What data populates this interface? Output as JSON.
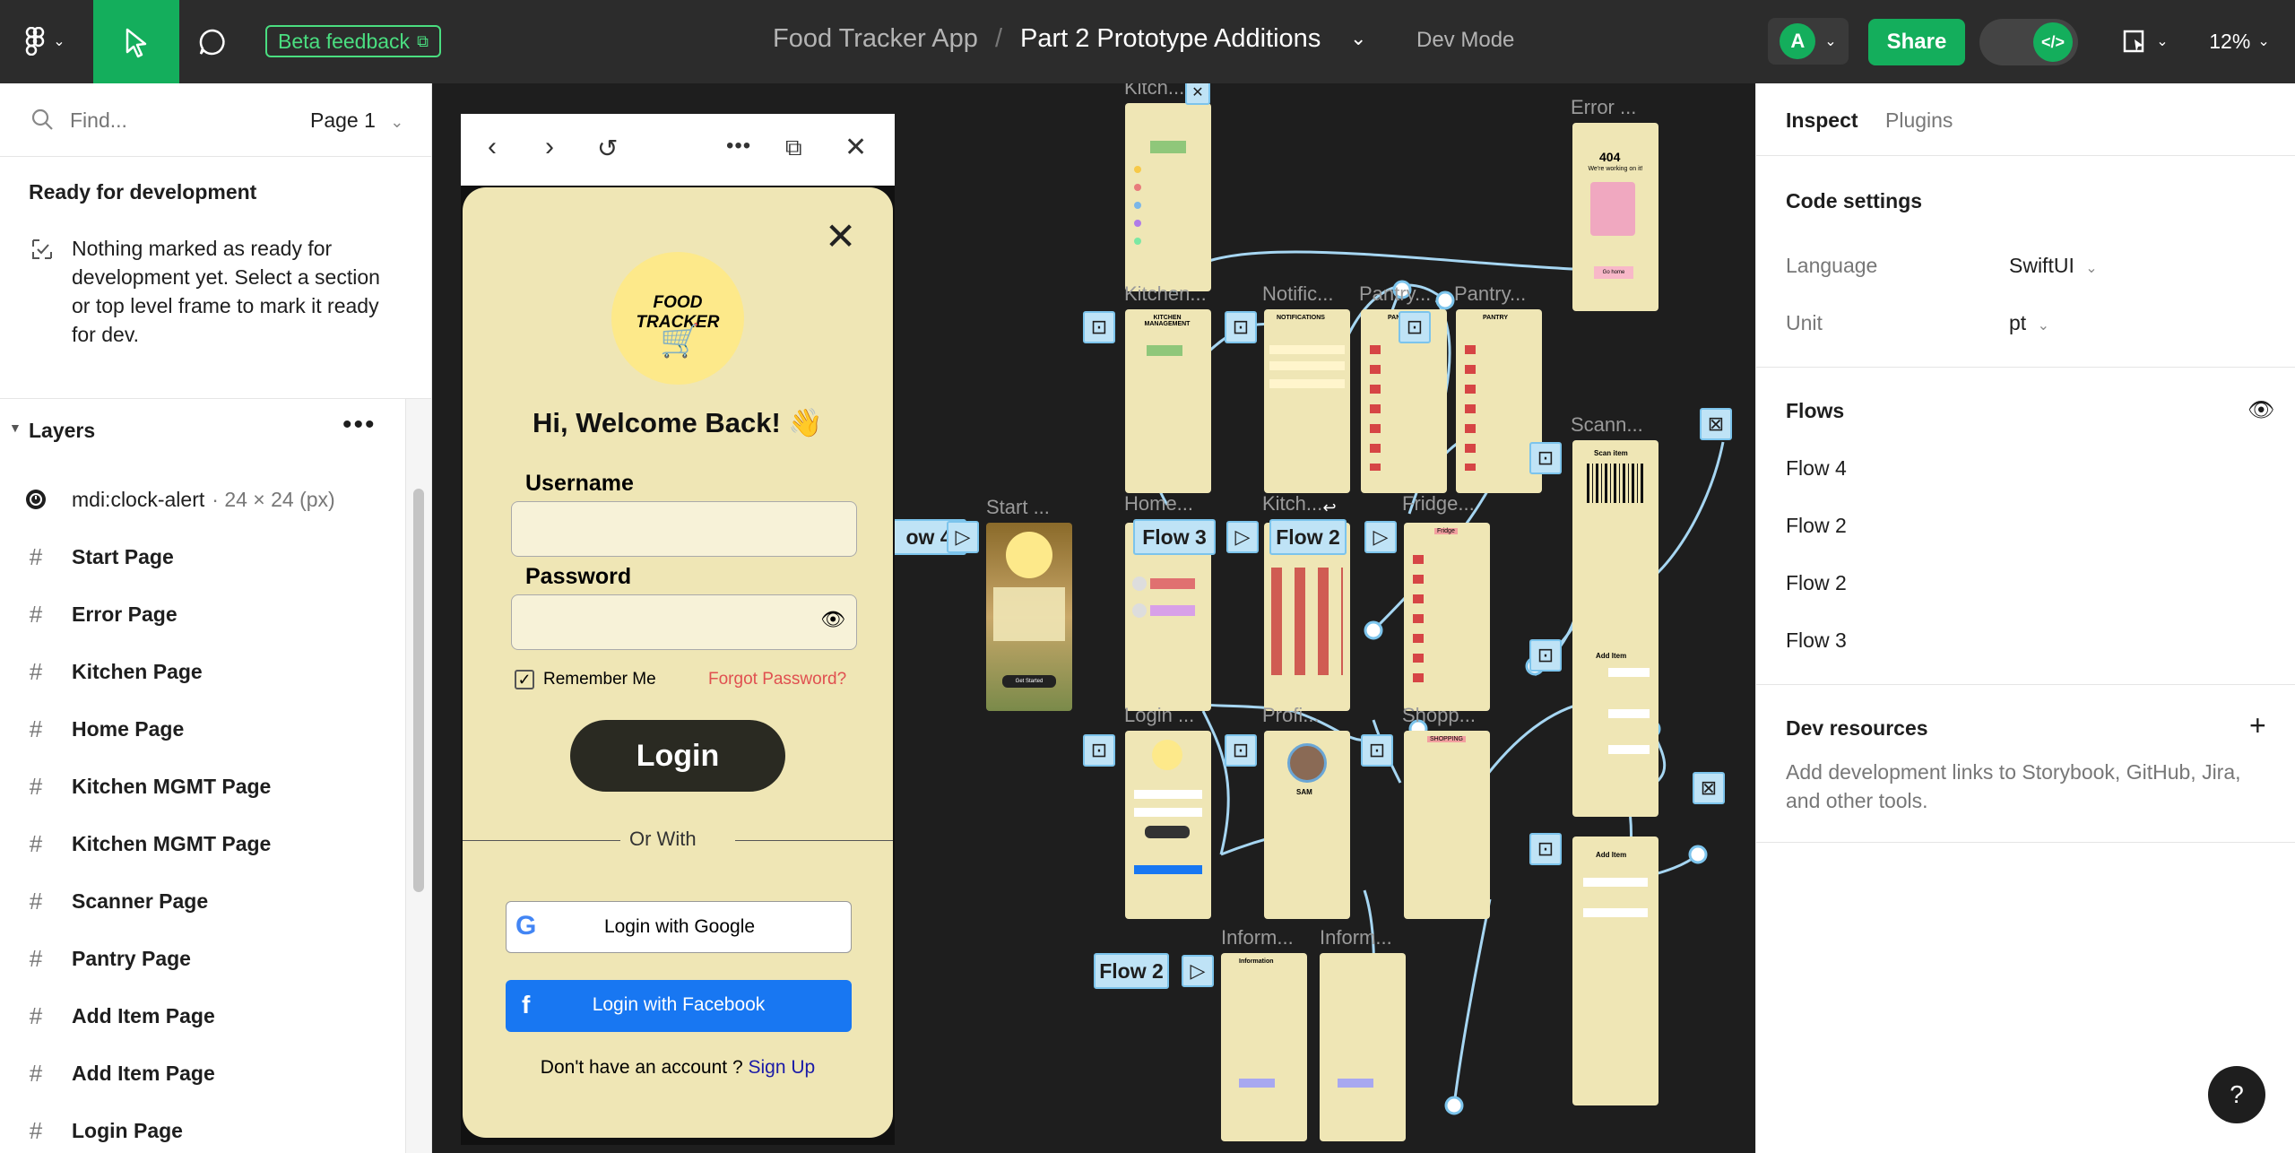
{
  "topbar": {
    "beta_label": "Beta feedback",
    "file_name": "Food Tracker App",
    "separator": "/",
    "page_name": "Part 2 Prototype Additions",
    "dev_mode": "Dev Mode",
    "avatar_letter": "A",
    "share_label": "Share",
    "zoom": "12%"
  },
  "left": {
    "search_placeholder": "Find...",
    "page_selector": "Page 1",
    "ready_title": "Ready for development",
    "ready_desc": "Nothing marked as ready for development yet. Select a section or top level frame to mark it ready for dev.",
    "layers_title": "Layers",
    "layers": [
      {
        "name": "mdi:clock-alert",
        "meta": "· 24 × 24 (px)"
      },
      {
        "name": "Start Page"
      },
      {
        "name": "Error Page"
      },
      {
        "name": "Kitchen Page"
      },
      {
        "name": "Home Page"
      },
      {
        "name": "Kitchen MGMT Page"
      },
      {
        "name": "Kitchen MGMT Page"
      },
      {
        "name": "Scanner Page"
      },
      {
        "name": "Pantry Page"
      },
      {
        "name": "Add Item Page"
      },
      {
        "name": "Add Item Page"
      },
      {
        "name": "Login Page"
      }
    ]
  },
  "preview": {
    "app_title": "FOOD TRACKER",
    "welcome": "Hi, Welcome Back! 👋",
    "username_label": "Username",
    "password_label": "Password",
    "remember": "Remember Me",
    "forgot": "Forgot Password?",
    "login": "Login",
    "or_with": "Or With",
    "google": "Login with Google",
    "facebook": "Login with Facebook",
    "no_account": "Don't have an account ?",
    "sign_up": "Sign Up"
  },
  "canvas_labels": {
    "kitchen1": "Kitch...",
    "kitchen2": "Kitchen...",
    "notific": "Notific...",
    "pantry1": "Pantry...",
    "pantry2": "Pantry...",
    "error": "Error ...",
    "scann": "Scann...",
    "start": "Start ...",
    "home": "Home...",
    "kitch3": "Kitch...",
    "fridge": "Fridge...",
    "login": "Login ...",
    "profile": "Profi...",
    "shopping": "Shopp...",
    "inform1": "Inform...",
    "inform2": "Inform...",
    "additem": "Add Item",
    "flow4": "ow 4",
    "flow3": "Flow 3",
    "flow2a": "Flow 2",
    "flow2b": "Flow 2",
    "err404": "404",
    "err_msg": "We're working on it!",
    "go_home": "Go home",
    "scan_item": "Scan item",
    "get_started": "Get Started",
    "sam": "SAM",
    "shopping_title": "SHOPPING",
    "information": "Information",
    "fridge_title": "Fridge",
    "pantry_title": "PANTRY",
    "kitchen_mgmt": "KITCHEN MANAGEMENT",
    "notifications": "NOTIFICATIONS"
  },
  "right": {
    "tab_inspect": "Inspect",
    "tab_plugins": "Plugins",
    "code_settings": "Code settings",
    "language_label": "Language",
    "language_value": "SwiftUI",
    "unit_label": "Unit",
    "unit_value": "pt",
    "flows_title": "Flows",
    "flows": [
      "Flow 4",
      "Flow 2",
      "Flow 2",
      "Flow 3"
    ],
    "dev_resources": "Dev resources",
    "dev_desc": "Add development links to Storybook, GitHub, Jira, and other tools.",
    "help": "?"
  },
  "colors": {
    "accent_green": "#14ae5c",
    "flow_blue": "#7cc4ec",
    "frame_bg": "#efe6b5"
  }
}
